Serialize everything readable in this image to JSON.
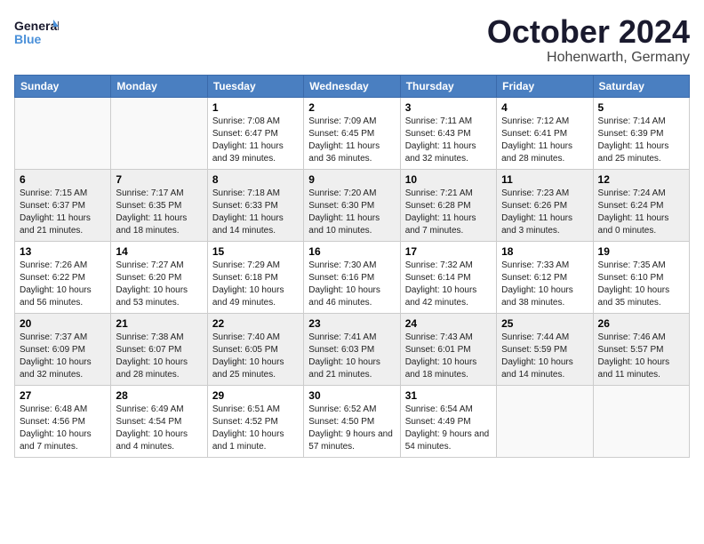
{
  "logo": {
    "line1": "General",
    "line2": "Blue"
  },
  "title": "October 2024",
  "location": "Hohenwarth, Germany",
  "weekdays": [
    "Sunday",
    "Monday",
    "Tuesday",
    "Wednesday",
    "Thursday",
    "Friday",
    "Saturday"
  ],
  "weeks": [
    [
      {
        "day": "",
        "detail": ""
      },
      {
        "day": "",
        "detail": ""
      },
      {
        "day": "1",
        "detail": "Sunrise: 7:08 AM\nSunset: 6:47 PM\nDaylight: 11 hours and 39 minutes."
      },
      {
        "day": "2",
        "detail": "Sunrise: 7:09 AM\nSunset: 6:45 PM\nDaylight: 11 hours and 36 minutes."
      },
      {
        "day": "3",
        "detail": "Sunrise: 7:11 AM\nSunset: 6:43 PM\nDaylight: 11 hours and 32 minutes."
      },
      {
        "day": "4",
        "detail": "Sunrise: 7:12 AM\nSunset: 6:41 PM\nDaylight: 11 hours and 28 minutes."
      },
      {
        "day": "5",
        "detail": "Sunrise: 7:14 AM\nSunset: 6:39 PM\nDaylight: 11 hours and 25 minutes."
      }
    ],
    [
      {
        "day": "6",
        "detail": "Sunrise: 7:15 AM\nSunset: 6:37 PM\nDaylight: 11 hours and 21 minutes."
      },
      {
        "day": "7",
        "detail": "Sunrise: 7:17 AM\nSunset: 6:35 PM\nDaylight: 11 hours and 18 minutes."
      },
      {
        "day": "8",
        "detail": "Sunrise: 7:18 AM\nSunset: 6:33 PM\nDaylight: 11 hours and 14 minutes."
      },
      {
        "day": "9",
        "detail": "Sunrise: 7:20 AM\nSunset: 6:30 PM\nDaylight: 11 hours and 10 minutes."
      },
      {
        "day": "10",
        "detail": "Sunrise: 7:21 AM\nSunset: 6:28 PM\nDaylight: 11 hours and 7 minutes."
      },
      {
        "day": "11",
        "detail": "Sunrise: 7:23 AM\nSunset: 6:26 PM\nDaylight: 11 hours and 3 minutes."
      },
      {
        "day": "12",
        "detail": "Sunrise: 7:24 AM\nSunset: 6:24 PM\nDaylight: 11 hours and 0 minutes."
      }
    ],
    [
      {
        "day": "13",
        "detail": "Sunrise: 7:26 AM\nSunset: 6:22 PM\nDaylight: 10 hours and 56 minutes."
      },
      {
        "day": "14",
        "detail": "Sunrise: 7:27 AM\nSunset: 6:20 PM\nDaylight: 10 hours and 53 minutes."
      },
      {
        "day": "15",
        "detail": "Sunrise: 7:29 AM\nSunset: 6:18 PM\nDaylight: 10 hours and 49 minutes."
      },
      {
        "day": "16",
        "detail": "Sunrise: 7:30 AM\nSunset: 6:16 PM\nDaylight: 10 hours and 46 minutes."
      },
      {
        "day": "17",
        "detail": "Sunrise: 7:32 AM\nSunset: 6:14 PM\nDaylight: 10 hours and 42 minutes."
      },
      {
        "day": "18",
        "detail": "Sunrise: 7:33 AM\nSunset: 6:12 PM\nDaylight: 10 hours and 38 minutes."
      },
      {
        "day": "19",
        "detail": "Sunrise: 7:35 AM\nSunset: 6:10 PM\nDaylight: 10 hours and 35 minutes."
      }
    ],
    [
      {
        "day": "20",
        "detail": "Sunrise: 7:37 AM\nSunset: 6:09 PM\nDaylight: 10 hours and 32 minutes."
      },
      {
        "day": "21",
        "detail": "Sunrise: 7:38 AM\nSunset: 6:07 PM\nDaylight: 10 hours and 28 minutes."
      },
      {
        "day": "22",
        "detail": "Sunrise: 7:40 AM\nSunset: 6:05 PM\nDaylight: 10 hours and 25 minutes."
      },
      {
        "day": "23",
        "detail": "Sunrise: 7:41 AM\nSunset: 6:03 PM\nDaylight: 10 hours and 21 minutes."
      },
      {
        "day": "24",
        "detail": "Sunrise: 7:43 AM\nSunset: 6:01 PM\nDaylight: 10 hours and 18 minutes."
      },
      {
        "day": "25",
        "detail": "Sunrise: 7:44 AM\nSunset: 5:59 PM\nDaylight: 10 hours and 14 minutes."
      },
      {
        "day": "26",
        "detail": "Sunrise: 7:46 AM\nSunset: 5:57 PM\nDaylight: 10 hours and 11 minutes."
      }
    ],
    [
      {
        "day": "27",
        "detail": "Sunrise: 6:48 AM\nSunset: 4:56 PM\nDaylight: 10 hours and 7 minutes."
      },
      {
        "day": "28",
        "detail": "Sunrise: 6:49 AM\nSunset: 4:54 PM\nDaylight: 10 hours and 4 minutes."
      },
      {
        "day": "29",
        "detail": "Sunrise: 6:51 AM\nSunset: 4:52 PM\nDaylight: 10 hours and 1 minute."
      },
      {
        "day": "30",
        "detail": "Sunrise: 6:52 AM\nSunset: 4:50 PM\nDaylight: 9 hours and 57 minutes."
      },
      {
        "day": "31",
        "detail": "Sunrise: 6:54 AM\nSunset: 4:49 PM\nDaylight: 9 hours and 54 minutes."
      },
      {
        "day": "",
        "detail": ""
      },
      {
        "day": "",
        "detail": ""
      }
    ]
  ]
}
